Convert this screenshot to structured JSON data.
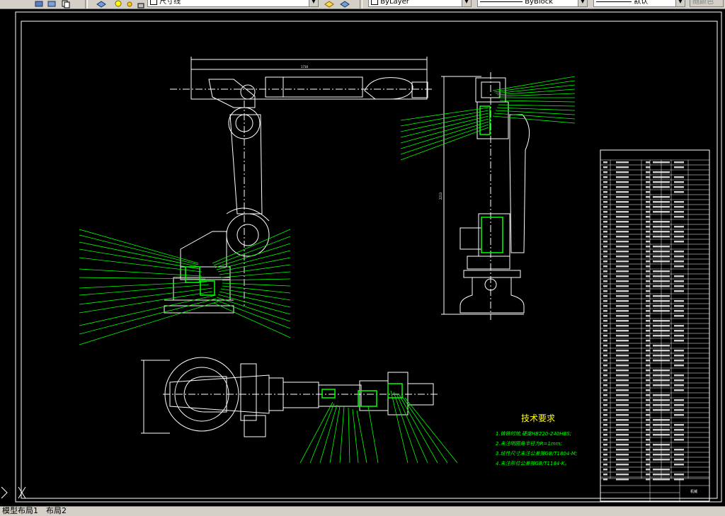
{
  "toolbar": {
    "layer_value": "尺寸线",
    "color_value": "ByLayer",
    "linetype_value": "ByBlock",
    "lineweight_value": "默认",
    "plotstyle_value": "随颜色"
  },
  "drawing": {
    "tech_title": "技术要求",
    "tech_lines": [
      "1.铸铁时效,硬度HB220-240HBS;",
      "2.未注明圆角半径为R=1mm;",
      "3.线性尺寸未注公差按GB/T1804-M;",
      "4.未注形位公差按GB/T1184-K。"
    ],
    "top_dimension": "1730",
    "side_dimension": "2213",
    "bom_title_cell": "机械"
  },
  "tabs": {
    "model": "模型",
    "layout1": "布局1",
    "layout2": "布局2"
  },
  "colors": {
    "background": "#000000",
    "geometry": "#ffffff",
    "leaders": "#00ff00",
    "tech_text": "#00ff00",
    "tech_title": "#ffff00"
  }
}
